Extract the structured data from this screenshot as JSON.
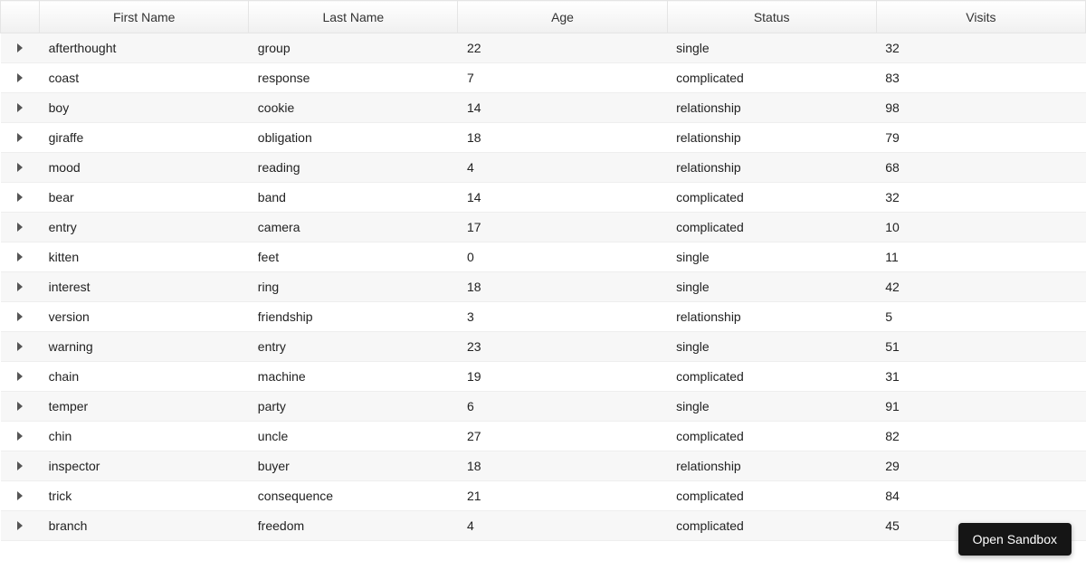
{
  "table": {
    "headers": {
      "firstName": "First Name",
      "lastName": "Last Name",
      "age": "Age",
      "status": "Status",
      "visits": "Visits"
    },
    "rows": [
      {
        "firstName": "afterthought",
        "lastName": "group",
        "age": "22",
        "status": "single",
        "visits": "32"
      },
      {
        "firstName": "coast",
        "lastName": "response",
        "age": "7",
        "status": "complicated",
        "visits": "83"
      },
      {
        "firstName": "boy",
        "lastName": "cookie",
        "age": "14",
        "status": "relationship",
        "visits": "98"
      },
      {
        "firstName": "giraffe",
        "lastName": "obligation",
        "age": "18",
        "status": "relationship",
        "visits": "79"
      },
      {
        "firstName": "mood",
        "lastName": "reading",
        "age": "4",
        "status": "relationship",
        "visits": "68"
      },
      {
        "firstName": "bear",
        "lastName": "band",
        "age": "14",
        "status": "complicated",
        "visits": "32"
      },
      {
        "firstName": "entry",
        "lastName": "camera",
        "age": "17",
        "status": "complicated",
        "visits": "10"
      },
      {
        "firstName": "kitten",
        "lastName": "feet",
        "age": "0",
        "status": "single",
        "visits": "11"
      },
      {
        "firstName": "interest",
        "lastName": "ring",
        "age": "18",
        "status": "single",
        "visits": "42"
      },
      {
        "firstName": "version",
        "lastName": "friendship",
        "age": "3",
        "status": "relationship",
        "visits": "5"
      },
      {
        "firstName": "warning",
        "lastName": "entry",
        "age": "23",
        "status": "single",
        "visits": "51"
      },
      {
        "firstName": "chain",
        "lastName": "machine",
        "age": "19",
        "status": "complicated",
        "visits": "31"
      },
      {
        "firstName": "temper",
        "lastName": "party",
        "age": "6",
        "status": "single",
        "visits": "91"
      },
      {
        "firstName": "chin",
        "lastName": "uncle",
        "age": "27",
        "status": "complicated",
        "visits": "82"
      },
      {
        "firstName": "inspector",
        "lastName": "buyer",
        "age": "18",
        "status": "relationship",
        "visits": "29"
      },
      {
        "firstName": "trick",
        "lastName": "consequence",
        "age": "21",
        "status": "complicated",
        "visits": "84"
      },
      {
        "firstName": "branch",
        "lastName": "freedom",
        "age": "4",
        "status": "complicated",
        "visits": "45"
      }
    ]
  },
  "buttons": {
    "openSandbox": "Open Sandbox"
  }
}
